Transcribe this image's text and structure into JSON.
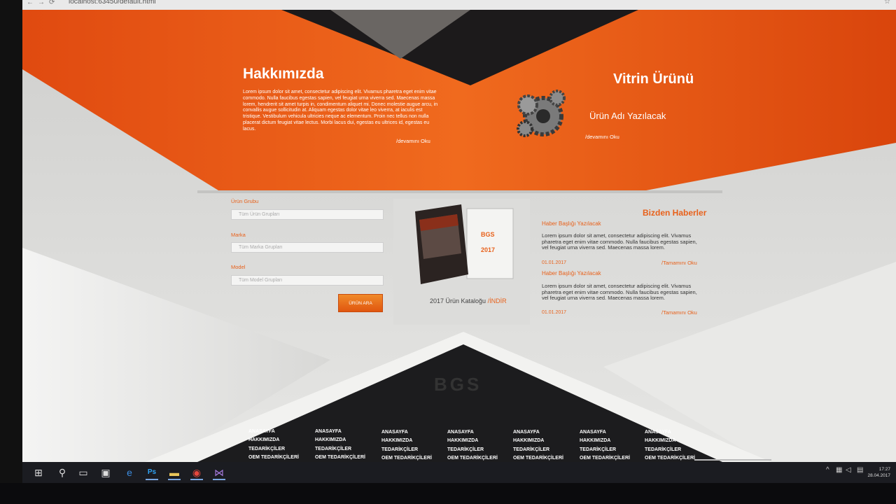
{
  "browser": {
    "url": "localhost:63450/default.html"
  },
  "about": {
    "title": "Hakkımızda",
    "text": "Lorem ipsum dolor sit amet, consectetur adipiscing elit. Vivamus pharetra eget enim vitae commodo. Nulla faucibus egestas sapien, vel feugiat urna viverra sed. Maecenas massa lorem, hendrerit sit amet turpis in, condimentum aliquet mi. Donec molestie augue arcu, in convallis augue sollicitudin at. Aliquam egestas dolor vitae leo viverra, at iaculis est tristique. Vestibulum vehicula ultricies neque ac elementum. Proin nec tellus non nulla placerat dictum feugiat vitae lectus. Morbi lacus dui, egestas eu ultrices id, egestas eu lacus.",
    "more": "/devamını Oku"
  },
  "showcase": {
    "title": "Vitrin Ürünü",
    "product_name": "Ürün Adı Yazılacak",
    "more": "/devamını Oku"
  },
  "search": {
    "group_label": "Ürün Grubu",
    "group_value": "Tüm Ürün Grupları",
    "brand_label": "Marka",
    "brand_value": "Tüm Marka Grupları",
    "model_label": "Model",
    "model_value": "Tüm Model Grupları",
    "button": "ÜRÜN ARA"
  },
  "catalog": {
    "label": "2017 Ürün Kataloğu",
    "link": "/İNDİR",
    "cover_brand": "BGS",
    "cover_year": "2017"
  },
  "news": {
    "heading": "Bizden Haberler",
    "items": [
      {
        "title": "Haber Başlığı Yazılacak",
        "body": "Lorem ipsum dolor sit amet, consectetur adipiscing elit. Vivamus pharetra eget enim vitae commodo. Nulla faucibus egestas sapien, vel feugiat urna viverra sed. Maecenas massa lorem.",
        "date": "01.01.2017",
        "more": "/Tamamını Oku"
      },
      {
        "title": "Haber Başlığı Yazılacak",
        "body": "Lorem ipsum dolor sit amet, consectetur adipiscing elit. Vivamus pharetra eget enim vitae commodo. Nulla faucibus egestas sapien, vel feugiat urna viverra sed. Maecenas massa lorem.",
        "date": "01.01.2017",
        "more": "/Tamamını Oku"
      }
    ]
  },
  "footer": {
    "logo": "BGS",
    "columns": [
      [
        "ANASAYFA",
        "HAKKIMIZDA",
        "TEDARİKÇİLER",
        "OEM TEDARİKÇİLERİ"
      ],
      [
        "ANASAYFA",
        "HAKKIMIZDA",
        "TEDARİKÇİLER",
        "OEM TEDARİKÇİLERİ"
      ],
      [
        "ANASAYFA",
        "HAKKIMIZDA",
        "TEDARİKÇİLER",
        "OEM TEDARİKÇİLERİ"
      ],
      [
        "ANASAYFA",
        "HAKKIMIZDA",
        "TEDARİKÇİLER",
        "OEM TEDARİKÇİLERİ"
      ],
      [
        "ANASAYFA",
        "HAKKIMIZDA",
        "TEDARİKÇİLER",
        "OEM TEDARİKÇİLERİ"
      ],
      [
        "ANASAYFA",
        "HAKKIMIZDA",
        "TEDARİKÇİLER",
        "OEM TEDARİKÇİLERİ"
      ],
      [
        "ANASAYFA",
        "HAKKIMIZDA",
        "TEDARİKÇİLER",
        "OEM TEDARİKÇİLERİ"
      ]
    ]
  },
  "taskbar": {
    "time": "17:27",
    "date": "28.04.2017",
    "apps": [
      "windows-start-icon",
      "search-icon",
      "task-view-icon",
      "store-icon",
      "edge-icon",
      "photoshop-icon",
      "file-explorer-icon",
      "chrome-icon",
      "visual-studio-icon"
    ]
  },
  "colors": {
    "accent": "#e8611b",
    "dark": "#1c1c1e",
    "bg": "#d4d4d2"
  }
}
